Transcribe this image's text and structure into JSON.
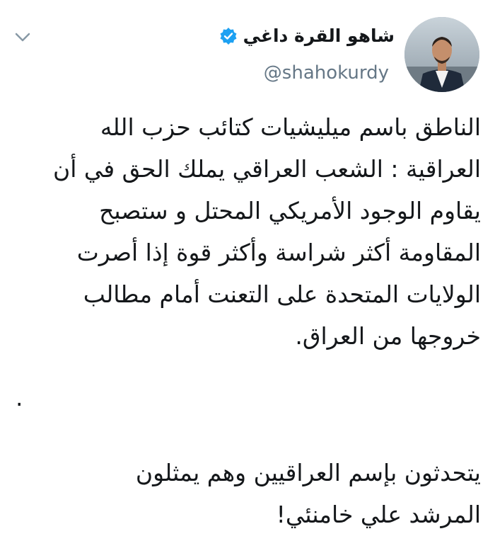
{
  "author": {
    "display_name": "شاهو القرة داغي",
    "handle": "@shahokurdy",
    "verified": true,
    "avatar_icon": "profile-photo"
  },
  "menu": {
    "icon": "chevron-down-icon"
  },
  "tweet": {
    "lines": [
      "الناطق باسم ميليشيات كتائب حزب الله",
      "العراقية : الشعب العراقي يملك الحق في أن",
      "يقاوم الوجود الأمريكي المحتل و ستصبح",
      "المقاومة أكثر شراسة وأكثر قوة إذا أصرت",
      "الولايات المتحدة على التعنت أمام مطالب",
      "خروجها من العراق."
    ],
    "separator": ".",
    "lines2": [
      "يتحدثون بإسم العراقيين وهم يمثلون",
      "المرشد علي خامنئي!"
    ]
  },
  "colors": {
    "verified_blue": "#1da1f2",
    "handle_gray": "#657786",
    "text": "#14171a"
  }
}
